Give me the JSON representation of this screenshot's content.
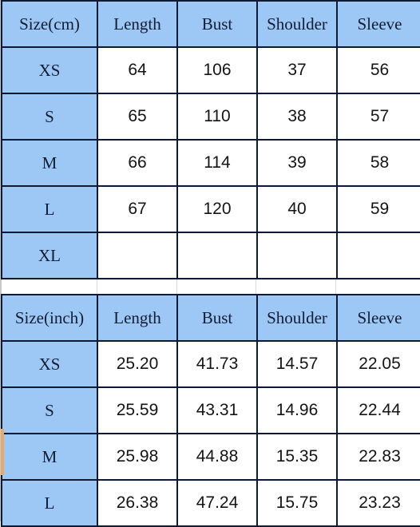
{
  "document": {
    "type": "garment-size-chart",
    "accent_blue": "#9DC8F5",
    "border_color": "#0D1A33",
    "marker_color": "#E8A96B"
  },
  "tables": [
    {
      "unit": "cm",
      "headers": [
        "Size(cm)",
        "Length",
        "Bust",
        "Shoulder",
        "Sleeve"
      ],
      "rows": [
        {
          "size": "XS",
          "values": [
            "64",
            "106",
            "37",
            "56"
          ]
        },
        {
          "size": "S",
          "values": [
            "65",
            "110",
            "38",
            "57"
          ]
        },
        {
          "size": "M",
          "values": [
            "66",
            "114",
            "39",
            "58"
          ]
        },
        {
          "size": "L",
          "values": [
            "67",
            "120",
            "40",
            "59"
          ]
        },
        {
          "size": "XL",
          "values": [
            "",
            "",
            "",
            ""
          ]
        }
      ]
    },
    {
      "unit": "inch",
      "headers": [
        "Size(inch)",
        "Length",
        "Bust",
        "Shoulder",
        "Sleeve"
      ],
      "rows": [
        {
          "size": "XS",
          "values": [
            "25.20",
            "41.73",
            "14.57",
            "22.05"
          ]
        },
        {
          "size": "S",
          "values": [
            "25.59",
            "43.31",
            "14.96",
            "22.44"
          ]
        },
        {
          "size": "M",
          "values": [
            "25.98",
            "44.88",
            "15.35",
            "22.83"
          ]
        },
        {
          "size": "L",
          "values": [
            "26.38",
            "47.24",
            "15.75",
            "23.23"
          ]
        }
      ]
    }
  ]
}
